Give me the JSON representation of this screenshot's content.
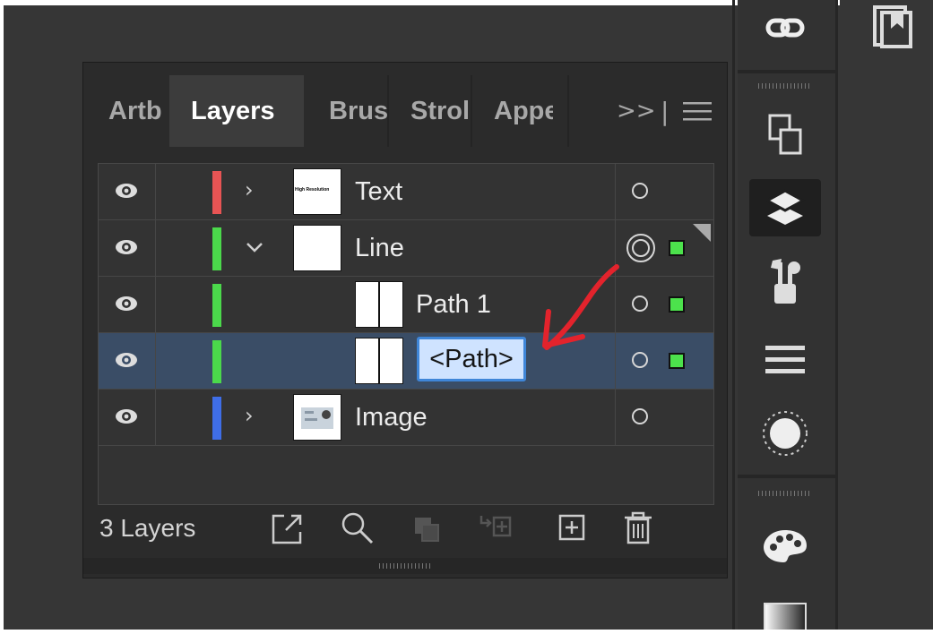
{
  "panel": {
    "tabs": [
      {
        "label": "Artb",
        "active": false
      },
      {
        "label": "Layers",
        "active": true
      },
      {
        "label": "Brus",
        "active": false
      },
      {
        "label": "Strol",
        "active": false
      },
      {
        "label": "Appe",
        "active": false
      }
    ],
    "overflow_label": ">>",
    "menu_icon": "hamburger-menu-icon"
  },
  "layers": [
    {
      "name": "Text",
      "color": "#e85454",
      "expanded": false,
      "indent": 0,
      "thumb_text": "High Resolution",
      "selected": false
    },
    {
      "name": "Line",
      "color": "#4bd94b",
      "expanded": true,
      "indent": 0,
      "thumb_text": "",
      "selected": false,
      "targeted": true
    },
    {
      "name": "Path 1",
      "color": "#4bd94b",
      "expanded": false,
      "indent": 1,
      "thumb_text": "",
      "selected": false
    },
    {
      "name": "<Path>",
      "color": "#4bd94b",
      "expanded": false,
      "indent": 1,
      "thumb_text": "",
      "selected": true,
      "editing": true
    },
    {
      "name": "Image",
      "color": "#3f6ee8",
      "expanded": false,
      "indent": 0,
      "thumb_text": "",
      "selected": false
    }
  ],
  "footer": {
    "count_label": "3 Layers",
    "buttons": [
      "export-icon",
      "search-icon",
      "clipping-mask-icon",
      "new-sublayer-icon",
      "new-layer-icon",
      "trash-icon"
    ]
  },
  "dock": {
    "icons": [
      "links-icon",
      "artboards-icon",
      "layers-icon",
      "brushes-icon",
      "stroke-icon",
      "appearance-icon",
      "color-palette-icon",
      "gradient-icon"
    ],
    "active": "layers-icon"
  },
  "far_right_icons": [
    "bookmark-icon"
  ],
  "colors": {
    "selection": "#3a4d66",
    "accent": "#3f86d8",
    "annotation_arrow": "#e3232c"
  }
}
